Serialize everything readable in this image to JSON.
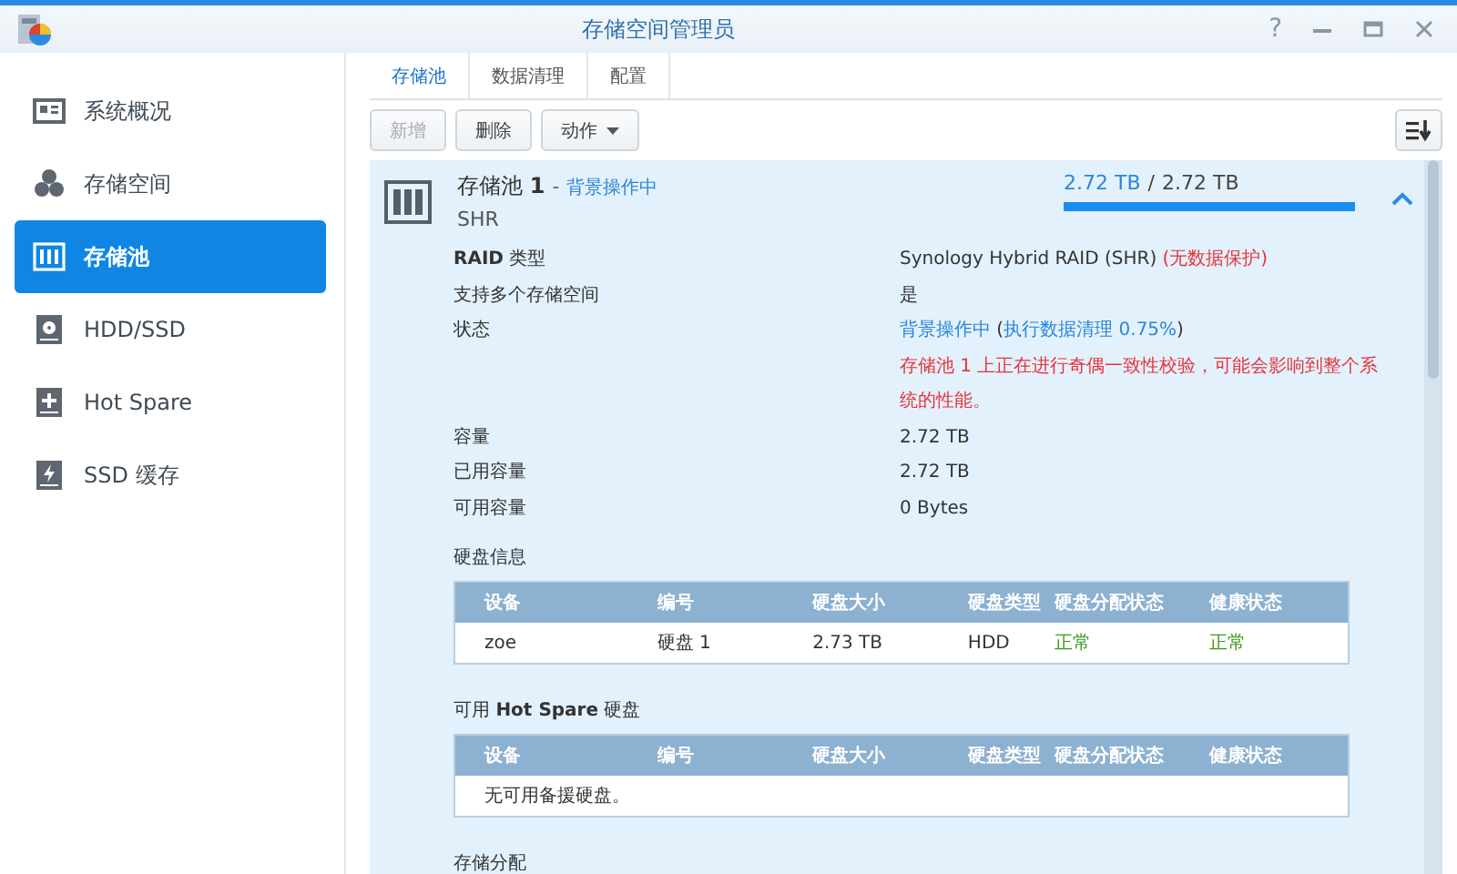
{
  "window": {
    "title": "存储空间管理员",
    "controls": [
      {
        "kind": "help",
        "label": "?"
      },
      {
        "kind": "minimize"
      },
      {
        "kind": "maximize"
      },
      {
        "kind": "close"
      }
    ]
  },
  "sidebar": {
    "items": [
      {
        "label": "系统概况",
        "kind": "overview",
        "selected": false
      },
      {
        "label": "存储空间",
        "kind": "volume",
        "selected": false
      },
      {
        "label": "存储池",
        "kind": "pool",
        "selected": true
      },
      {
        "label": "HDD/SSD",
        "kind": "disk",
        "selected": false
      },
      {
        "label": "Hot Spare",
        "kind": "spare",
        "selected": false
      },
      {
        "label": "SSD 缓存",
        "kind": "cache",
        "selected": false
      }
    ]
  },
  "tabs": [
    {
      "label": "存储池",
      "selected": true
    },
    {
      "label": "数据清理",
      "selected": false
    },
    {
      "label": "配置",
      "selected": false
    }
  ],
  "toolbar": {
    "buttons": [
      {
        "label": "新增",
        "disabled": true,
        "dropdown": false
      },
      {
        "label": "删除",
        "disabled": false,
        "dropdown": false
      },
      {
        "label": "动作",
        "disabled": false,
        "dropdown": true
      }
    ]
  },
  "pool": {
    "name": "存储池 **1**",
    "name_separator": "-",
    "status": "背景操作中",
    "capacity_separator": "/",
    "type": "SHR",
    "used": "2.72 TB",
    "total": "2.72 TB",
    "level": 1,
    "expanded": true,
    "details": [
      {
        "label": "**RAID** 类型",
        "value": [
          {
            "text": "Synology Hybrid RAID (SHR) ",
            "kind": "normal"
          },
          {
            "text": "(无数据保护)",
            "kind": "error"
          }
        ]
      },
      {
        "label": "支持多个存储空间",
        "value": [
          {
            "text": "是",
            "kind": "normal"
          }
        ]
      },
      {
        "label": "状态",
        "value": [
          {
            "text": "背景操作中",
            "kind": "link"
          },
          {
            "text": " (",
            "kind": "normal"
          },
          {
            "text": "执行数据清理 0.75%",
            "kind": "link"
          },
          {
            "text": ")",
            "kind": "normal"
          }
        ],
        "note": "存储池 1 上正在进行奇偶一致性校验，可能会影响到整个系统的性能。"
      },
      {
        "label": "容量",
        "value": [
          {
            "text": "2.72 TB",
            "kind": "normal"
          }
        ]
      },
      {
        "label": "已用容量",
        "value": [
          {
            "text": "2.72 TB",
            "kind": "normal"
          }
        ]
      },
      {
        "label": "可用容量",
        "value": [
          {
            "text": "0 Bytes",
            "kind": "normal"
          }
        ]
      }
    ],
    "tables": [
      {
        "title": "硬盘信息",
        "columns": [
          "设备",
          "编号",
          "硬盘大小",
          "硬盘类型",
          "硬盘分配状态",
          "健康状态"
        ],
        "rows": [
          [
            {
              "text": "zoe",
              "kind": "normal"
            },
            {
              "text": "硬盘 1",
              "kind": "normal"
            },
            {
              "text": "2.73 TB",
              "kind": "normal"
            },
            {
              "text": "HDD",
              "kind": "normal"
            },
            {
              "text": "正常",
              "kind": "ok"
            },
            {
              "text": "正常",
              "kind": "ok"
            }
          ]
        ]
      },
      {
        "title": "可用 **Hot Spare** 硬盘",
        "columns": [
          "设备",
          "编号",
          "硬盘大小",
          "硬盘类型",
          "硬盘分配状态",
          "健康状态"
        ],
        "empty": "无可用备援硬盘。"
      }
    ],
    "section": "存储分配"
  }
}
